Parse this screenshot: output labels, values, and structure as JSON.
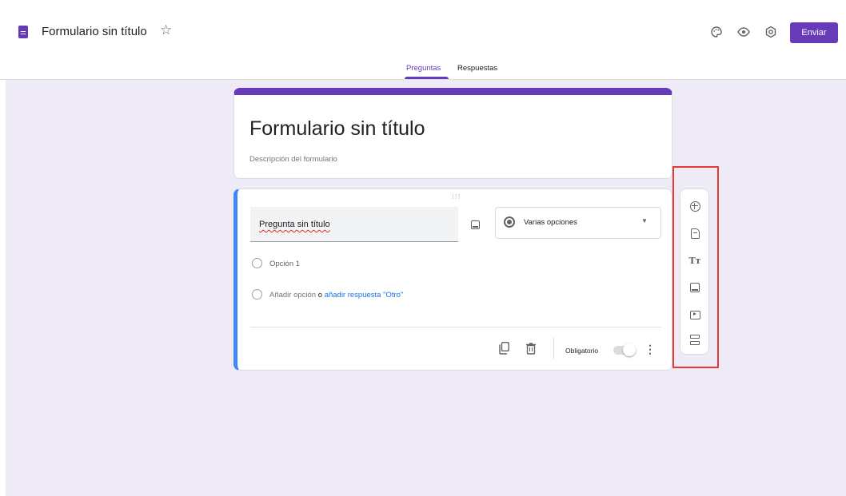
{
  "header": {
    "app_title": "Formulario sin título",
    "send_label": "Enviar",
    "icons": [
      "doc-icon",
      "star-icon",
      "palette-icon",
      "preview-eye-icon",
      "settings-icon"
    ]
  },
  "tabs": [
    {
      "label": "Preguntas",
      "active": true
    },
    {
      "label": "Respuestas",
      "active": false
    }
  ],
  "form": {
    "title": "Formulario sin título",
    "description_placeholder": "Descripción del formulario"
  },
  "question": {
    "title": "Pregunta sin título",
    "type": "Varias opciones",
    "options": [
      "Opción 1"
    ],
    "add_option_label": "Añadir opción",
    "or_label": "o",
    "add_other_label": "añadir respuesta \"Otro\"",
    "required_label": "Obligatorio",
    "required": false
  },
  "side_toolbar": {
    "icons": [
      "add-question-icon",
      "import-questions-icon",
      "add-title-icon",
      "add-image-icon",
      "add-video-icon",
      "add-section-icon"
    ]
  },
  "colors": {
    "accent": "#673ab7",
    "canvas": "#efebf6",
    "active_card_border": "#4285f4",
    "highlight": "#e53935",
    "link": "#1a73e8"
  }
}
